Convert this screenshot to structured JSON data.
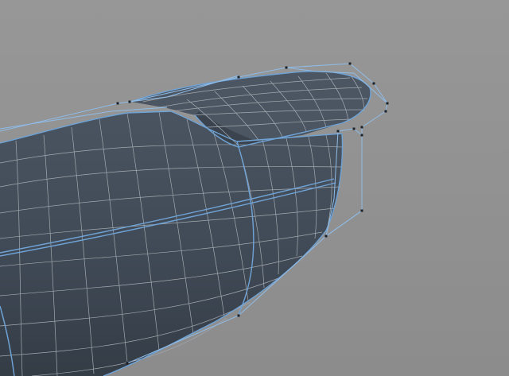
{
  "viewport": {
    "background_top": "#979797",
    "background_bottom": "#8c8c8c",
    "mesh_fill": "#414b57",
    "mesh_fill_dark": "#323a44",
    "mesh_top_fill": "#4c5663",
    "wire_color": "#a3a9af",
    "edge_color": "#6fa3d6",
    "cage_color": "#8fbce8",
    "cage_point_color": "#1d2228"
  },
  "icons": {
    "model": "nurbs-surface-object",
    "cage": "control-cage"
  }
}
